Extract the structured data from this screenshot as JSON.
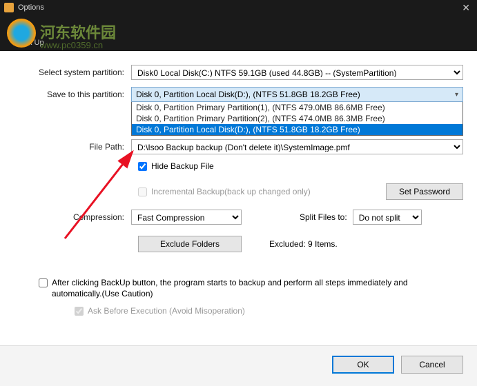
{
  "window": {
    "title": "Options",
    "close": "✕"
  },
  "header": {
    "label": "Back Up",
    "wm1": "河东软件园",
    "wm2": "www.pc0359.cn"
  },
  "labels": {
    "system_partition": "Select system partition:",
    "save_to": "Save to this partition:",
    "file_path": "File Path:",
    "hide_backup": "Hide Backup File",
    "incremental": "Incremental Backup(back up changed only)",
    "set_password": "Set Password",
    "compression": "Compression:",
    "split_to": "Split Files to:",
    "exclude_folders": "Exclude Folders",
    "excluded_items": "Excluded: 9 Items.",
    "auto_backup": "After clicking BackUp button, the program starts to backup and perform all steps immediately and automatically.(Use Caution)",
    "ask_before": "Ask Before Execution (Avoid Misoperation)"
  },
  "values": {
    "system_partition": "Disk0  Local Disk(C:) NTFS 59.1GB (used 44.8GB) -- (SystemPartition)",
    "save_to_selected": "Disk 0, Partition Local Disk(D:), (NTFS 51.8GB 18.2GB Free)",
    "save_to_options": [
      "Disk 0, Partition Primary Partition(1), (NTFS 479.0MB 86.6MB Free)",
      "Disk 0, Partition Primary Partition(2), (NTFS 474.0MB 86.3MB Free)",
      "Disk 0, Partition Local Disk(D:), (NTFS 51.8GB 18.2GB Free)"
    ],
    "file_path": "D:\\Isoo Backup backup (Don't delete it)\\SystemImage.pmf",
    "compression": "Fast Compression",
    "split": "Do not split"
  },
  "footer": {
    "ok": "OK",
    "cancel": "Cancel"
  }
}
